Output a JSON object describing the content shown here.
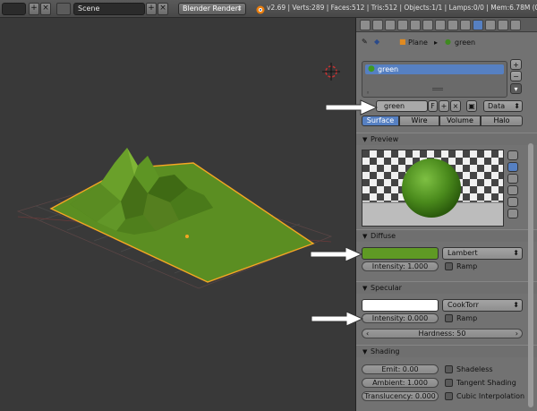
{
  "header": {
    "scene": "Scene",
    "render_engine": "Blender Render",
    "stats": "v2.69 | Verts:289 | Faces:512 | Tris:512 | Objects:1/1 | Lamps:0/0 | Mem:6.78M (0.55M)"
  },
  "breadcrumb": {
    "object": "Plane",
    "material": "green"
  },
  "slot": {
    "name": "green"
  },
  "material_field": {
    "name": "green",
    "fake_user": "F",
    "link": "Data"
  },
  "type_tabs": [
    "Surface",
    "Wire",
    "Volume",
    "Halo"
  ],
  "preview": {
    "title": "Preview"
  },
  "diffuse": {
    "title": "Diffuse",
    "color": "#5f9a24",
    "shader": "Lambert",
    "intensity": "Intensity: 1.000",
    "ramp": "Ramp"
  },
  "specular": {
    "title": "Specular",
    "color": "#ffffff",
    "shader": "CookTorr",
    "intensity": "Intensity: 0.000",
    "ramp": "Ramp",
    "hardness": "Hardness: 50"
  },
  "shading": {
    "title": "Shading",
    "emit": "Emit: 0.00",
    "ambient": "Ambient: 1.000",
    "translucency": "Translucency: 0.000",
    "shadeless": "Shadeless",
    "tangent": "Tangent Shading",
    "cubic": "Cubic Interpolation"
  },
  "colors": {
    "terrain": "#5b8e22",
    "outline": "#f5a623",
    "accent": "#5680c2"
  }
}
